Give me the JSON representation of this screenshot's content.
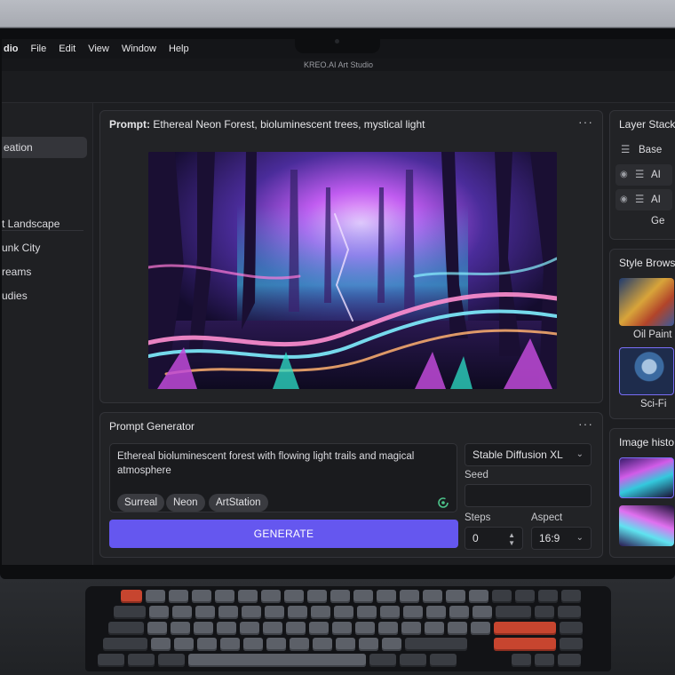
{
  "menubar": {
    "app": "dio",
    "items": [
      "File",
      "Edit",
      "View",
      "Window",
      "Help"
    ]
  },
  "window_title": "KREO.AI Art Studio",
  "sidebar": {
    "items": [
      {
        "label": "eation",
        "active": true
      },
      {
        "label": "t Landscape"
      },
      {
        "label": "unk City"
      },
      {
        "label": "reams"
      },
      {
        "label": "udies"
      }
    ]
  },
  "preview": {
    "prompt_label": "Prompt:",
    "prompt_text": "Ethereal Neon Forest, bioluminescent trees, mystical light",
    "menu_icon": "more-horizontal-icon"
  },
  "generator": {
    "title": "Prompt Generator",
    "prompt_value": "Ethereal bioluminescent forest with flowing light trails and magical atmosphere",
    "tags": [
      "Surreal",
      "Neon",
      "ArtStation"
    ],
    "generate_label": "GENERATE",
    "model": "Stable Diffusion XL",
    "seed_label": "Seed",
    "seed_value": "",
    "steps_label": "Steps",
    "steps_value": "0",
    "aspect_label": "Aspect",
    "aspect_value": "16:9",
    "accent": "#6557ef"
  },
  "layer_stack": {
    "title": "Layer Stack",
    "layers": [
      {
        "label": "Base"
      },
      {
        "label": "AI Ge"
      },
      {
        "label": "AI Ge"
      }
    ]
  },
  "style_browser": {
    "title": "Style Browse",
    "styles": [
      {
        "label": "Oil Paint"
      },
      {
        "label": "Sci-Fi",
        "selected": true
      }
    ]
  },
  "image_history": {
    "title": "Image histo"
  }
}
